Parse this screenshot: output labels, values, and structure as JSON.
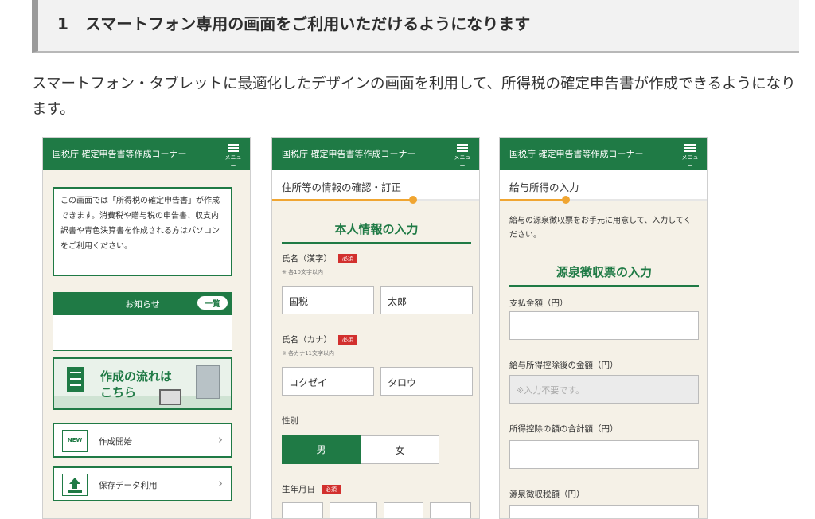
{
  "heading": {
    "number": "1",
    "text": "スマートフォン専用の画面をご利用いただけるようになります"
  },
  "intro": "スマートフォン・タブレットに最適化したデザインの画面を利用して、所得税の確定申告書が作成できるようになります。",
  "colors": {
    "brand_green": "#1f7a45",
    "accent_orange": "#f0a531",
    "required_red": "#d2302e"
  },
  "app": {
    "title": "国税庁 確定申告書等作成コーナー",
    "menu_label": "メニュー",
    "menu_icon": "hamburger-icon"
  },
  "phone1": {
    "notice": "この画面では「所得税の確定申告書」が作成できます。消費税や贈与税の申告書、収支内訳書や青色決算書を作成される方はパソコンをご利用ください。",
    "news_title": "お知らせ",
    "news_button": "一覧",
    "flow_line1": "作成の流れは",
    "flow_line2": "こちら",
    "menu": [
      {
        "label": "作成開始",
        "icon": "new-document-icon",
        "icon_text": "NEW"
      },
      {
        "label": "保存データ利用",
        "icon": "upload-data-icon",
        "icon_text": ""
      }
    ]
  },
  "phone2": {
    "step_title": "住所等の情報の確認・訂正",
    "progress": 0.68,
    "section_title": "本人情報の入力",
    "required_label": "必須",
    "name_kanji_label": "氏名（漢字）",
    "name_kanji_note": "※ 各10文字以内",
    "last_name_kanji": "国税",
    "first_name_kanji": "太郎",
    "name_kana_label": "氏名（カナ）",
    "name_kana_note": "※ 各カナ11文字以内",
    "last_name_kana": "コクゼイ",
    "first_name_kana": "タロウ",
    "gender_label": "性別",
    "gender_options": [
      "男",
      "女"
    ],
    "gender_selected": "男",
    "birth_label": "生年月日"
  },
  "phone3": {
    "step_title": "給与所得の入力",
    "progress": 0.32,
    "info": "給与の源泉徴収票をお手元に用意して、入力してください。",
    "section_title": "源泉徴収票の入力",
    "fields": [
      {
        "label": "支払金額（円）",
        "value": "",
        "placeholder": ""
      },
      {
        "label": "給与所得控除後の金額（円）",
        "value": "",
        "placeholder": "※入力不要です。"
      },
      {
        "label": "所得控除の額の合計額（円）",
        "value": "",
        "placeholder": ""
      },
      {
        "label": "源泉徴収税額（円）",
        "value": "",
        "placeholder": ""
      }
    ]
  }
}
